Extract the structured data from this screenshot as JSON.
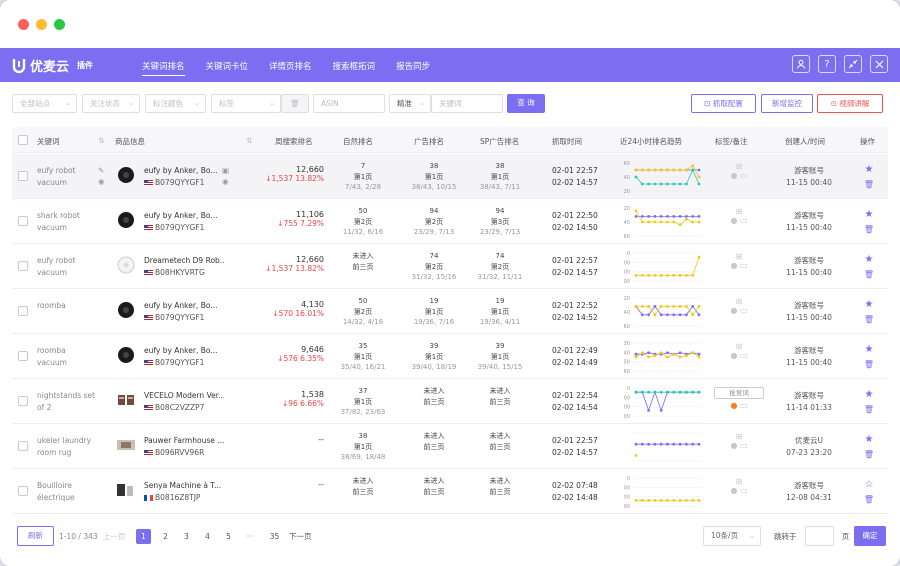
{
  "window": {
    "controls": [
      "close",
      "minimize",
      "zoom"
    ]
  },
  "app": {
    "name": "优麦云",
    "tag": "插件"
  },
  "nav": [
    "关键词排名",
    "关键词卡位",
    "详情页排名",
    "搜索框拓词",
    "报告同步"
  ],
  "filters": {
    "site": "全部站点",
    "status": "关注状态",
    "color": "标注颜色",
    "tag": "标签",
    "asin": "ASIN",
    "match": "精准",
    "keyword": "关键词",
    "query": "查 询",
    "fetch_config": "抓取配置",
    "add_monitor": "新增监控",
    "video": "视频讲解"
  },
  "columns": {
    "keyword": "关键词",
    "product": "商品信息",
    "weekly": "周搜索排名",
    "natural": "自然排名",
    "ad": "广告排名",
    "sp": "SP广告排名",
    "fetch_time": "抓取时间",
    "trend": "近24小时排名趋势",
    "tags": "标签/备注",
    "creator": "创建人/时间",
    "ops": "操作"
  },
  "rows": [
    {
      "kw": [
        "eufy robot",
        "vacuum"
      ],
      "title": "eufy by Anker, Bo...",
      "asin": "B079QYYGF1",
      "flag": "us",
      "img": "round",
      "sv": "12,660",
      "delta": "↓1,537",
      "pct": "13.82%",
      "nat": [
        "7",
        "第1页",
        "7/43, 2/28"
      ],
      "ad": [
        "38",
        "第1页",
        "38/43, 10/15"
      ],
      "sp": [
        "38",
        "第1页",
        "38/43, 7/11"
      ],
      "t1": "02-01 22:57",
      "t2": "02-02 14:57",
      "creator": "游客账号",
      "ctime": "11-15 00:40",
      "fav": true
    },
    {
      "kw": [
        "shark robot",
        "vacuum"
      ],
      "title": "eufy by Anker, Bo...",
      "asin": "B079QYYGF1",
      "flag": "us",
      "img": "round",
      "sv": "11,106",
      "delta": "↓755",
      "pct": "7.29%",
      "nat": [
        "50",
        "第2页",
        "11/32, 6/16"
      ],
      "ad": [
        "94",
        "第2页",
        "23/29, 7/13"
      ],
      "sp": [
        "94",
        "第3页",
        "23/29, 7/13"
      ],
      "t1": "02-01 22:50",
      "t2": "02-02 14:50",
      "creator": "游客账号",
      "ctime": "11-15 00:40",
      "fav": true
    },
    {
      "kw": [
        "eufy robot",
        "vacuum"
      ],
      "title": "Dreametech D9 Rob...",
      "asin": "B08HKYVRTG",
      "flag": "us",
      "img": "white",
      "sv": "12,660",
      "delta": "↓1,537",
      "pct": "13.82%",
      "nat": [
        "未进入",
        "前三页",
        ""
      ],
      "ad": [
        "74",
        "第2页",
        "31/32, 15/16"
      ],
      "sp": [
        "74",
        "第2页",
        "31/32, 11/11"
      ],
      "t1": "02-01 22:57",
      "t2": "02-02 14:57",
      "creator": "游客账号",
      "ctime": "11-15 00:40",
      "fav": true
    },
    {
      "kw": [
        "roomba",
        ""
      ],
      "title": "eufy by Anker, Bo...",
      "asin": "B079QYYGF1",
      "flag": "us",
      "img": "round",
      "sv": "4,130",
      "delta": "↓570",
      "pct": "16.01%",
      "nat": [
        "50",
        "第2页",
        "14/32, 4/16"
      ],
      "ad": [
        "19",
        "第1页",
        "19/36, 7/16"
      ],
      "sp": [
        "19",
        "第1页",
        "19/36, 4/11"
      ],
      "t1": "02-01 22:52",
      "t2": "02-02 14:52",
      "creator": "游客账号",
      "ctime": "11-15 00:40",
      "fav": true
    },
    {
      "kw": [
        "roomba",
        "vacuum"
      ],
      "title": "eufy by Anker, Bo...",
      "asin": "B079QYYGF1",
      "flag": "us",
      "img": "round",
      "sv": "9,646",
      "delta": "↓576",
      "pct": "6.35%",
      "nat": [
        "35",
        "第1页",
        "35/40, 16/21"
      ],
      "ad": [
        "39",
        "第1页",
        "39/40, 18/19"
      ],
      "sp": [
        "39",
        "第1页",
        "39/40, 15/15"
      ],
      "t1": "02-01 22:49",
      "t2": "02-02 14:49",
      "creator": "游客账号",
      "ctime": "11-15 00:40",
      "fav": true
    },
    {
      "kw": [
        "nightstands set",
        "of 2"
      ],
      "title": "VECELO Modern Ver...",
      "asin": "B08C2VZZP7",
      "flag": "us",
      "img": "table",
      "sv": "1,538",
      "delta": "↓96",
      "pct": "6.66%",
      "nat": [
        "37",
        "第1页",
        "37/82, 23/63"
      ],
      "ad": [
        "未进入",
        "前三页",
        ""
      ],
      "sp": [
        "未进入",
        "前三页",
        ""
      ],
      "t1": "02-01 22:54",
      "t2": "02-02 14:54",
      "creator": "游客账号",
      "ctime": "11-14 01:33",
      "fav": true,
      "badge": "批竞词"
    },
    {
      "kw": [
        "ukeler laundry",
        "room rug"
      ],
      "title": "Pauwer Farmhouse ...",
      "asin": "B096RVV96R",
      "flag": "us",
      "img": "rug",
      "sv": "--",
      "delta": "",
      "pct": "",
      "nat": [
        "38",
        "第1页",
        "38/69, 18/48"
      ],
      "ad": [
        "未进入",
        "前三页",
        ""
      ],
      "sp": [
        "未进入",
        "前三页",
        ""
      ],
      "t1": "02-01 22:57",
      "t2": "02-02 14:57",
      "creator": "优麦云U",
      "ctime": "07-23 23:20",
      "fav": true
    },
    {
      "kw": [
        "Bouilloire",
        "électrique"
      ],
      "title": "Senya Machine à T...",
      "asin": "B0816Z8TJP",
      "flag": "fr",
      "img": "kettle",
      "sv": "--",
      "delta": "",
      "pct": "",
      "nat": [
        "未进入",
        "前三页",
        ""
      ],
      "ad": [
        "未进入",
        "前三页",
        ""
      ],
      "sp": [
        "未进入",
        "前三页",
        ""
      ],
      "t1": "02-02 07:48",
      "t2": "02-02 14:48",
      "creator": "游客账号",
      "ctime": "12-08 04:31",
      "fav": false
    }
  ],
  "pager": {
    "refresh": "刷新",
    "range": "1-10 / 343",
    "prev": "上一页",
    "pages": [
      "1",
      "2",
      "3",
      "4",
      "5",
      "···",
      "35"
    ],
    "next": "下一页",
    "size": "10条/页",
    "jump": "跳转于",
    "unit": "页",
    "confirm": "确定"
  },
  "colors": {
    "accent": "#7b6ef0",
    "down": "#e84545",
    "teal": "#2ec4b6",
    "yellow": "#f2c811",
    "orange": "#f0821e"
  }
}
